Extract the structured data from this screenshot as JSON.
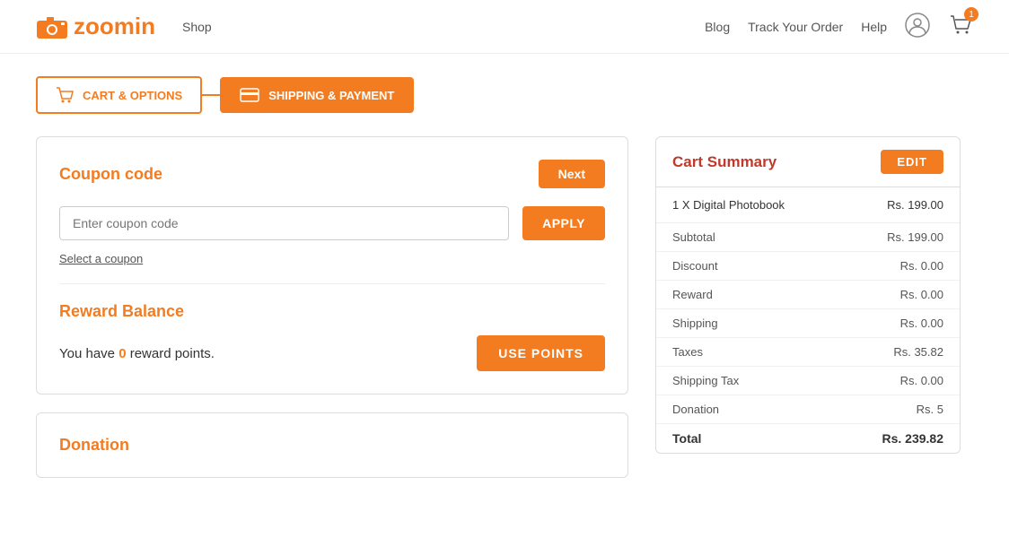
{
  "header": {
    "logo_text": "zoomin",
    "nav": [
      {
        "label": "Shop",
        "href": "#"
      }
    ],
    "links": [
      {
        "label": "Blog",
        "href": "#"
      },
      {
        "label": "Track Your Order",
        "href": "#"
      },
      {
        "label": "Help",
        "href": "#"
      }
    ],
    "cart_badge": "1"
  },
  "steps": [
    {
      "label": "CART & OPTIONS",
      "active": false
    },
    {
      "label": "SHIPPING & PAYMENT",
      "active": true
    }
  ],
  "coupon": {
    "title": "Coupon code",
    "next_label": "Next",
    "input_placeholder": "Enter coupon code",
    "apply_label": "APPLY",
    "select_link": "Select a coupon"
  },
  "reward": {
    "title": "Reward Balance",
    "text_prefix": "You have ",
    "points": "0",
    "text_suffix": " reward points.",
    "button_label": "USE POINTS"
  },
  "donation": {
    "title": "Donation"
  },
  "cart_summary": {
    "title": "Cart Summary",
    "edit_label": "EDIT",
    "item_name": "1 X Digital Photobook",
    "item_price": "Rs. 199.00",
    "rows": [
      {
        "label": "Subtotal",
        "value": "Rs. 199.00"
      },
      {
        "label": "Discount",
        "value": "Rs. 0.00"
      },
      {
        "label": "Reward",
        "value": "Rs. 0.00"
      },
      {
        "label": "Shipping",
        "value": "Rs. 0.00"
      },
      {
        "label": "Taxes",
        "value": "Rs. 35.82"
      },
      {
        "label": "Shipping Tax",
        "value": "Rs. 0.00"
      },
      {
        "label": "Donation",
        "value": "Rs. 5"
      }
    ],
    "total_label": "Total",
    "total_value": "Rs. 239.82"
  }
}
